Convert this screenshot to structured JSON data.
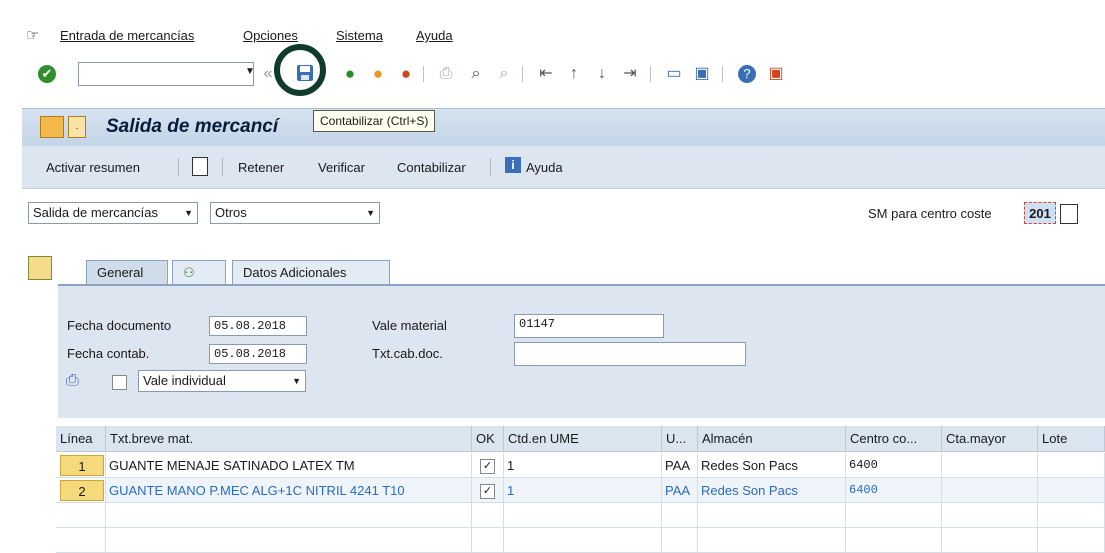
{
  "menu": {
    "items": [
      "Entrada de mercancías",
      "Opciones",
      "Sistema",
      "Ayuda"
    ]
  },
  "toolbar": {
    "command_value": "",
    "icons": [
      "check-icon",
      "save-icon",
      "back-icon",
      "exit-icon",
      "cancel-icon",
      "print-icon",
      "find-icon",
      "find-next-icon",
      "first-page-icon",
      "prev-page-icon",
      "next-page-icon",
      "last-page-icon",
      "new-session-icon",
      "shortcut-icon",
      "help-icon",
      "customize-icon"
    ]
  },
  "title": {
    "text": "Salida de mercancí",
    "tooltip": "Contabilizar   (Ctrl+S)"
  },
  "actions": {
    "overview": "Activar resumen",
    "hold": "Retener",
    "check": "Verificar",
    "post": "Contabilizar",
    "help": "Ayuda"
  },
  "header": {
    "transaction": "Salida de mercancías",
    "reference": "Otros",
    "movement_label": "SM para centro coste",
    "movement_type": "201"
  },
  "tabs": {
    "general": "General",
    "additional": "Datos Adicionales"
  },
  "fields": {
    "doc_date_label": "Fecha documento",
    "doc_date": "05.08.2018",
    "post_date_label": "Fecha contab.",
    "post_date": "05.08.2018",
    "slip_label": "Vale material",
    "slip": "01147",
    "header_text_label": "Txt.cab.doc.",
    "header_text": "",
    "print_option": "Vale individual"
  },
  "table": {
    "columns": [
      "Línea",
      "Txt.breve mat.",
      "OK",
      "Ctd.en UME",
      "U...",
      "Almacén",
      "Centro co...",
      "Cta.mayor",
      "Lote"
    ],
    "rows": [
      {
        "line": "1",
        "text": "GUANTE MENAJE SATINADO LATEX TM",
        "ok": "✓",
        "qty": "1",
        "unit": "PAA",
        "storage": "Redes Son Pacs",
        "cost_center": "6400",
        "gl": "",
        "batch": ""
      },
      {
        "line": "2",
        "text": "GUANTE MANO P.MEC ALG+1C NITRIL 4241 T10",
        "ok": "✓",
        "qty": "1",
        "unit": "PAA",
        "storage": "Redes Son Pacs",
        "cost_center": "6400",
        "gl": "",
        "batch": ""
      }
    ]
  },
  "colors": {
    "highlight_circle": "#0f3b2c",
    "row2_text": "#2a6bbf"
  }
}
